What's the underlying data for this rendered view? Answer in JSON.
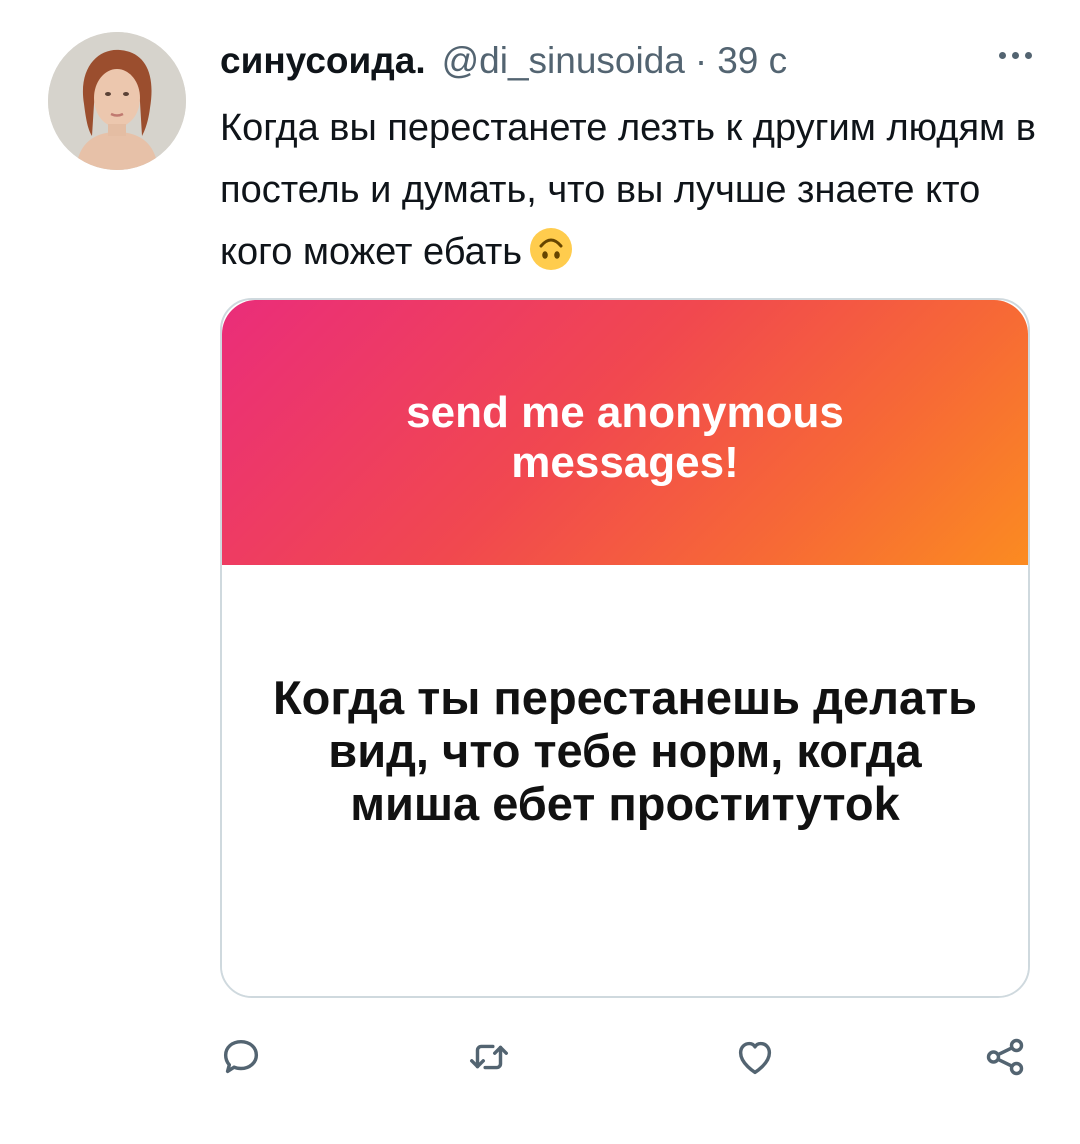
{
  "tweet": {
    "display_name": "синусоида.",
    "handle": "@di_sinusoida",
    "separator": "·",
    "time": "39 с",
    "text": "Когда вы перестанете лезть к другим людям в постель и думать, что вы лучше знаете кто кого может ебать",
    "emoji_icon": "upside-down-face-icon"
  },
  "media": {
    "header_text": "send me anonymous messages!",
    "question_text": "Когда ты перестанешь делать вид, что тебе норм, когда миша ебет проститутоk"
  },
  "actions": {
    "reply_icon": "reply-icon",
    "retweet_icon": "retweet-icon",
    "like_icon": "heart-icon",
    "share_icon": "share-icon"
  },
  "colors": {
    "secondary_text": "#536471",
    "border": "#cfd9de",
    "gradient_start": "#ea2d7a",
    "gradient_end": "#fb8b21"
  }
}
